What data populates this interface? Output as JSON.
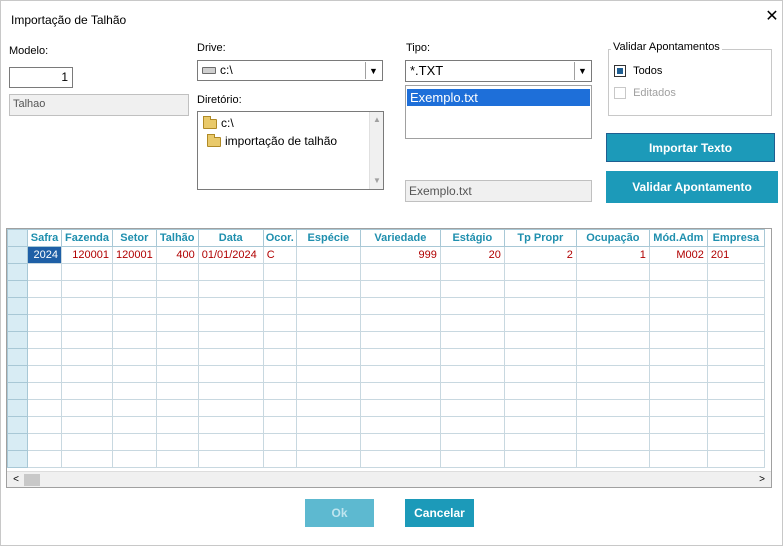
{
  "window": {
    "title": "Importação de Talhão",
    "close_glyph": "✕"
  },
  "modelo": {
    "label": "Modelo:",
    "value": "1",
    "name": "Talhao"
  },
  "drive": {
    "label": "Drive:",
    "value": "c:\\",
    "icon": "drive-icon"
  },
  "diretorio": {
    "label": "Diretório:",
    "items": [
      "c:\\",
      "importação de talhão"
    ]
  },
  "tipo": {
    "label": "Tipo:",
    "value": "*.TXT",
    "files": [
      "Exemplo.txt"
    ]
  },
  "filename": {
    "value": "Exemplo.txt"
  },
  "validar": {
    "label": "Validar Apontamentos",
    "options": [
      {
        "label": "Todos",
        "checked": true,
        "enabled": true
      },
      {
        "label": "Editados",
        "checked": false,
        "enabled": false
      }
    ]
  },
  "buttons": {
    "importar": "Importar Texto",
    "validar": "Validar Apontamento",
    "ok": "Ok",
    "cancelar": "Cancelar"
  },
  "grid": {
    "columns": [
      "Safra",
      "Fazenda",
      "Setor",
      "Talhão",
      "Data",
      "Ocor.",
      "Espécie",
      "Variedade",
      "Estágio",
      "Tp Propr",
      "Ocupação",
      "Mód.Adm",
      "Empresa"
    ],
    "rows": [
      [
        "2024",
        "120001",
        "120001",
        "400",
        "01/01/2024",
        "C",
        "",
        "999",
        "20",
        "2",
        "1",
        "M002",
        "201"
      ]
    ],
    "empty_rows": 12
  },
  "colors": {
    "accent": "#1c9ab9",
    "selection": "#1e5fa6",
    "cell_text": "#b00000",
    "header_text": "#1f8fae"
  }
}
